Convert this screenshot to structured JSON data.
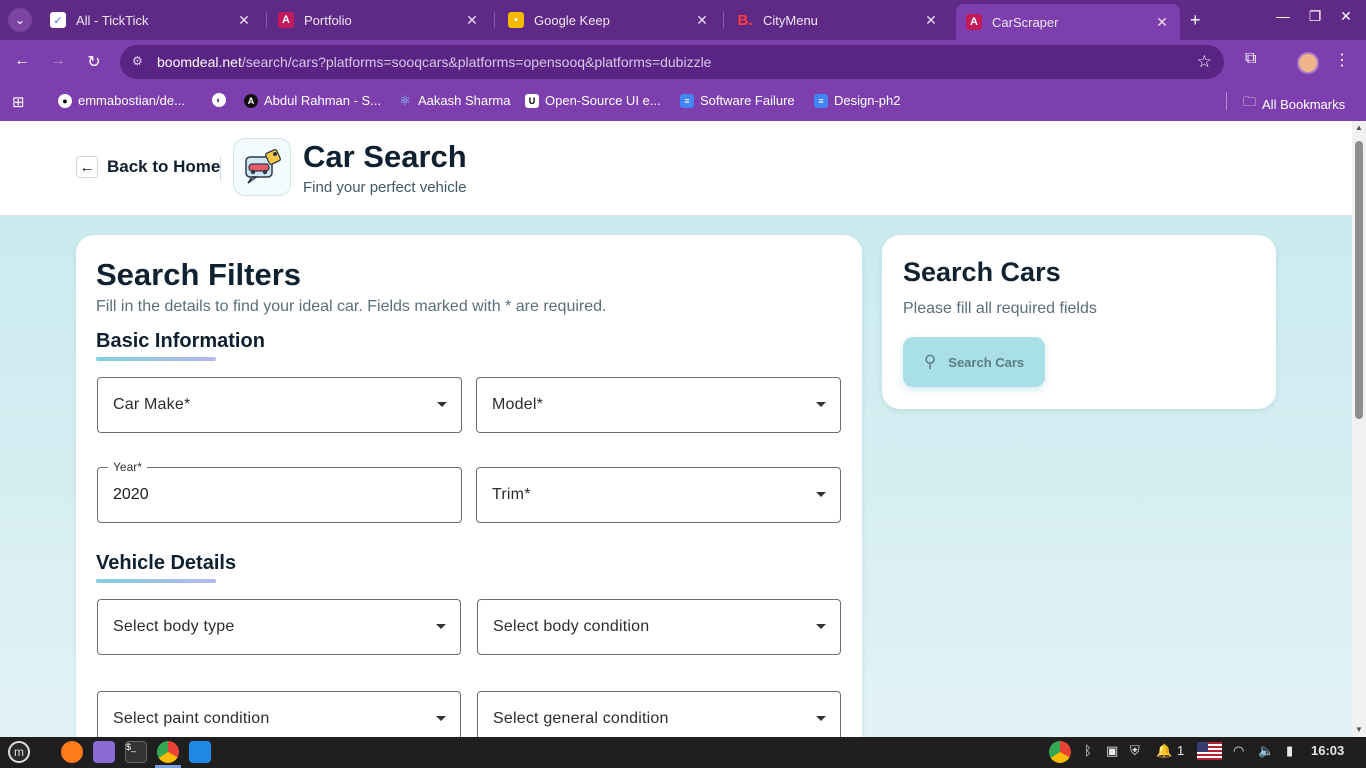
{
  "browser": {
    "tabs": [
      {
        "title": "All - TickTick",
        "icon": "ticktick-icon",
        "color": "#4b6bfb"
      },
      {
        "title": "Portfolio",
        "icon": "angular-icon",
        "color": "#c3185a"
      },
      {
        "title": "Google Keep",
        "icon": "keep-icon",
        "color": "#f6b800"
      },
      {
        "title": "CityMenu",
        "icon": "citymenu-icon",
        "color": "#e53935"
      },
      {
        "title": "CarScraper",
        "icon": "angular-icon",
        "color": "#c3185a"
      }
    ],
    "url_host": "boomdeal.net",
    "url_path": "/search/cars?platforms=sooqcars&platforms=opensooq&platforms=dubizzle",
    "bookmarks": [
      {
        "label": "emmabostian/de...",
        "icon": "github-icon"
      },
      {
        "label": "",
        "icon": "globe-icon"
      },
      {
        "label": "Abdul Rahman - S...",
        "icon": "a-logo-icon"
      },
      {
        "label": "Aakash Sharma",
        "icon": "react-icon"
      },
      {
        "label": "Open-Source UI e...",
        "icon": "ui-logo-icon"
      },
      {
        "label": "Software Failure",
        "icon": "docs-icon"
      },
      {
        "label": "Design-ph2",
        "icon": "docs-icon"
      }
    ],
    "all_bookmarks": "All Bookmarks"
  },
  "header": {
    "back_label": "Back to Home",
    "title": "Car Search",
    "subtitle": "Find your perfect vehicle"
  },
  "filters": {
    "title": "Search Filters",
    "description": "Fill in the details to find your ideal car. Fields marked with * are required.",
    "basic_section": "Basic Information",
    "make_placeholder": "Car Make*",
    "model_placeholder": "Model*",
    "year_label": "Year*",
    "year_value": "2020",
    "trim_placeholder": "Trim*",
    "vehicle_section": "Vehicle Details",
    "body_type_placeholder": "Select body type",
    "body_condition_placeholder": "Select body condition",
    "paint_condition_placeholder": "Select paint condition",
    "general_condition_placeholder": "Select general condition"
  },
  "side": {
    "title": "Search Cars",
    "description": "Please fill all required fields",
    "button_label": "Search Cars"
  },
  "taskbar": {
    "clock": "16:03",
    "notification_count": "1"
  }
}
